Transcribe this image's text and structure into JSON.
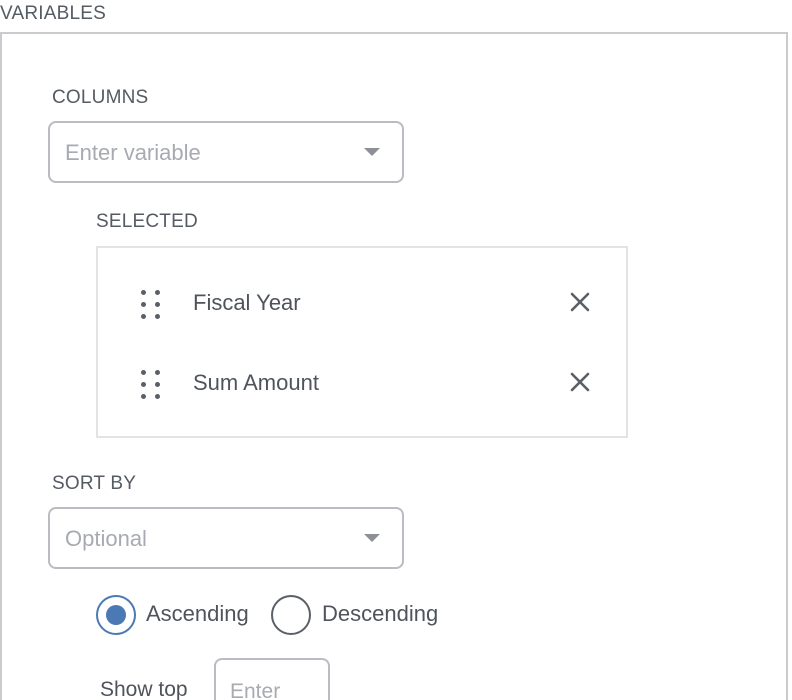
{
  "section": {
    "title": "VARIABLES"
  },
  "columns": {
    "label": "COLUMNS",
    "placeholder": "Enter variable"
  },
  "selected": {
    "label": "SELECTED",
    "items": [
      {
        "label": "Fiscal Year"
      },
      {
        "label": "Sum Amount"
      }
    ]
  },
  "sort": {
    "label": "SORT BY",
    "placeholder": "Optional",
    "options": [
      {
        "label": "Ascending",
        "checked": true
      },
      {
        "label": "Descending",
        "checked": false
      }
    ]
  },
  "show_top": {
    "label": "Show top",
    "placeholder": "Enter"
  },
  "colors": {
    "accent": "#4b79b4",
    "border": "#b9bcc1",
    "text": "#4f545c",
    "placeholder": "#a7abb1"
  },
  "icons": {
    "dropdown": "chevron-down-icon",
    "drag": "drag-handle-icon",
    "remove": "close-icon"
  }
}
